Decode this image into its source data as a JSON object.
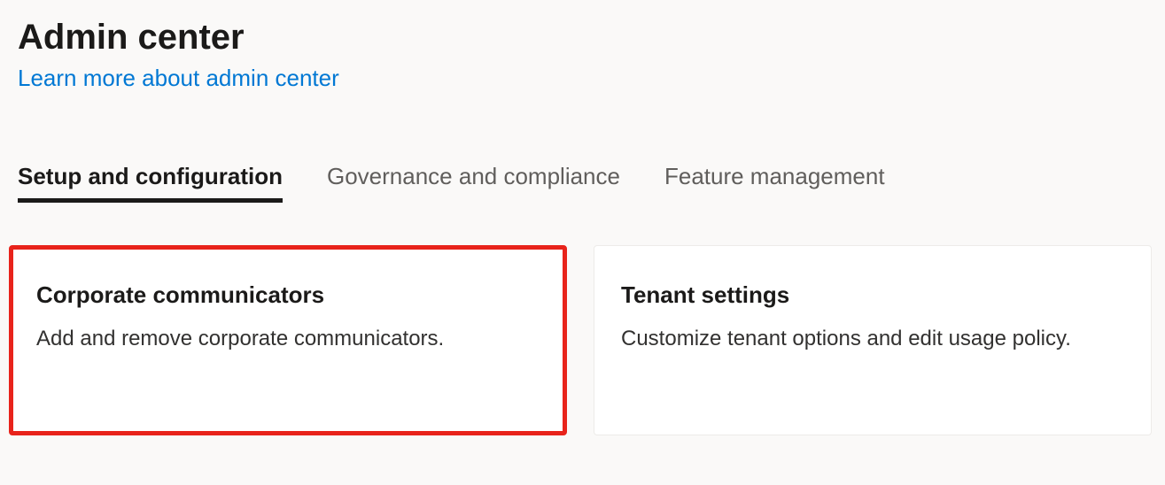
{
  "header": {
    "title": "Admin center",
    "learn_more": "Learn more about admin center"
  },
  "tabs": [
    {
      "label": "Setup and configuration",
      "active": true
    },
    {
      "label": "Governance and compliance",
      "active": false
    },
    {
      "label": "Feature management",
      "active": false
    }
  ],
  "cards": [
    {
      "title": "Corporate communicators",
      "description": "Add and remove corporate communicators.",
      "highlighted": true
    },
    {
      "title": "Tenant settings",
      "description": "Customize tenant options and edit usage policy.",
      "highlighted": false
    }
  ],
  "colors": {
    "link": "#0078d4",
    "highlight_border": "#e8231b",
    "text_primary": "#1b1a19",
    "text_secondary": "#605e5c",
    "background": "#faf9f8",
    "card_background": "#ffffff"
  }
}
